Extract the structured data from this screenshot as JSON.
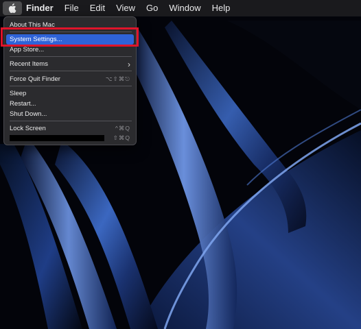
{
  "menubar": {
    "apple_icon": "apple-logo-icon",
    "app_name": "Finder",
    "items": [
      "File",
      "Edit",
      "View",
      "Go",
      "Window",
      "Help"
    ]
  },
  "apple_menu": {
    "items": [
      {
        "label": "About This Mac",
        "shortcut": ""
      },
      {
        "label": "System Settings...",
        "shortcut": "",
        "highlighted": true
      },
      {
        "label": "App Store...",
        "shortcut": ""
      },
      {
        "label": "Recent Items",
        "shortcut": "",
        "submenu": true
      },
      {
        "label": "Force Quit Finder",
        "shortcut": "⌥⇧⌘⎋"
      },
      {
        "label": "Sleep",
        "shortcut": ""
      },
      {
        "label": "Restart...",
        "shortcut": ""
      },
      {
        "label": "Shut Down...",
        "shortcut": ""
      },
      {
        "label": "Lock Screen",
        "shortcut": "^⌘Q"
      },
      {
        "label": "",
        "shortcut": "⇧⌘Q",
        "redacted": true
      }
    ]
  },
  "colors": {
    "highlight": "#2f63d8",
    "annotation": "#e0142a",
    "menu_background": "#2c2c30"
  }
}
